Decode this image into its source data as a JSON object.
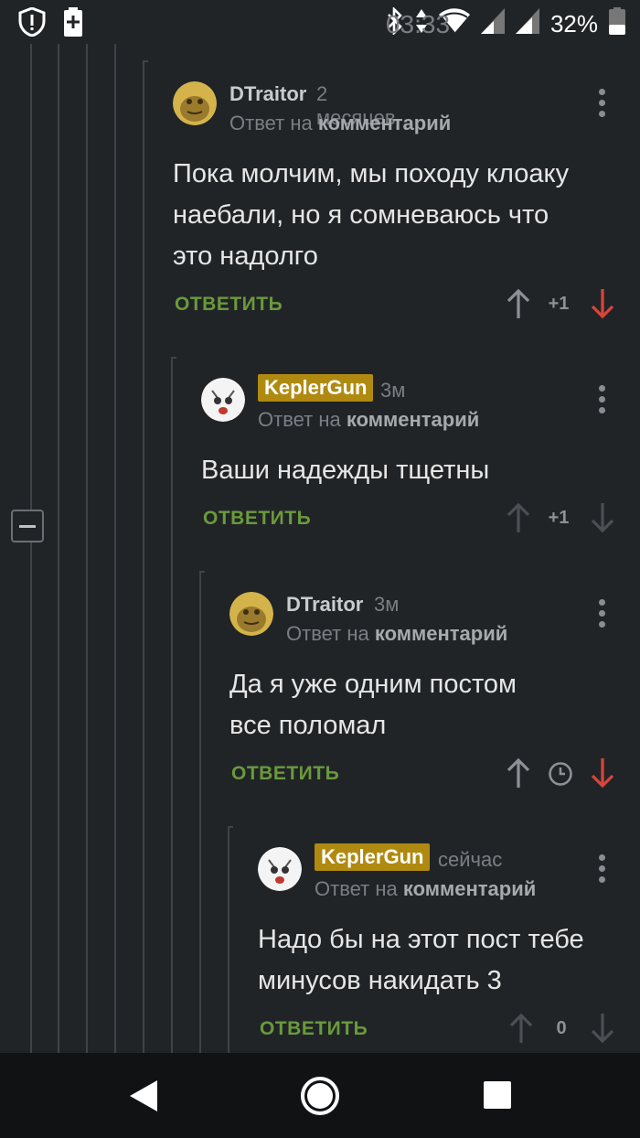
{
  "status_bar": {
    "battery_percent": "32%",
    "time": "03:33"
  },
  "comments": [
    {
      "author": "DTraitor",
      "time": "2 месяцев",
      "reply_prefix": "Ответ на",
      "reply_link": "комментарий",
      "text_lines": [
        "Пока молчим, мы походу клоаку",
        "наебали, но я сомневаюсь что",
        "это надолго"
      ],
      "reply_label": "ОТВЕТИТЬ",
      "rating": "+1"
    },
    {
      "author": "KeplerGun",
      "time": "3м",
      "reply_prefix": "Ответ на",
      "reply_link": "комментарий",
      "text_lines": [
        "Ваши надежды тщетны"
      ],
      "reply_label": "ОТВЕТИТЬ",
      "rating": "+1"
    },
    {
      "author": "DTraitor",
      "time": "3м",
      "reply_prefix": "Ответ на",
      "reply_link": "комментарий",
      "text_lines": [
        "Да я уже одним постом",
        "все поломал"
      ],
      "reply_label": "ОТВЕТИТЬ",
      "rating": ""
    },
    {
      "author": "KeplerGun",
      "time": "сейчас",
      "reply_prefix": "Ответ на",
      "reply_link": "комментарий",
      "text_lines": [
        "Надо бы на этот пост тебе",
        "минусов накидать 3"
      ],
      "reply_label": "ОТВЕТИТЬ",
      "rating": "0"
    }
  ],
  "colors": {
    "background": "#212427",
    "author_badge": "#b08a10",
    "reply_green": "#6a9a3c",
    "downvote_red": "#d9453a",
    "muted": "#7b7f83"
  },
  "icons": [
    "alert-shield-icon",
    "battery-saver-icon",
    "bluetooth-icon",
    "data-arrows-icon",
    "wifi-icon",
    "signal-icon",
    "battery-icon",
    "more-vert-icon",
    "upvote-arrow-icon",
    "downvote-arrow-icon",
    "clock-icon",
    "collapse-icon",
    "nav-back-icon",
    "nav-home-icon",
    "nav-recents-icon"
  ]
}
